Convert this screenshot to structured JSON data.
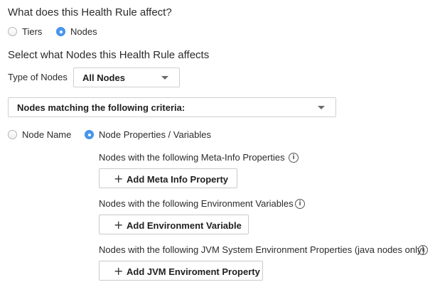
{
  "affect": {
    "title": "What does this Health Rule affect?",
    "options": [
      {
        "label": "Tiers",
        "selected": false
      },
      {
        "label": "Nodes",
        "selected": true
      }
    ]
  },
  "select_nodes": {
    "title": "Select what Nodes this Health Rule affects",
    "type_label": "Type of Nodes",
    "type_value": "All Nodes",
    "criteria_value": "Nodes matching the following criteria:"
  },
  "criteria_mode": {
    "options": [
      {
        "label": "Node Name",
        "selected": false
      },
      {
        "label": "Node Properties / Variables",
        "selected": true
      }
    ]
  },
  "groups": {
    "meta": {
      "label": "Nodes with the following Meta-Info Properties",
      "button": "Add Meta Info Property"
    },
    "env": {
      "label": "Nodes with the following Environment Variables",
      "button": "Add Environment Variable"
    },
    "jvm": {
      "label": "Nodes with the following JVM System Environment Properties (java nodes only)",
      "button": "Add JVM Enviroment Property"
    }
  },
  "icons": {
    "info": "info-icon",
    "plus": "plus-icon",
    "dropdown": "chevron-down-icon"
  },
  "colors": {
    "radio_selected": "#4a96ef",
    "border": "#cfcfcf",
    "text": "#2b2b2b"
  }
}
